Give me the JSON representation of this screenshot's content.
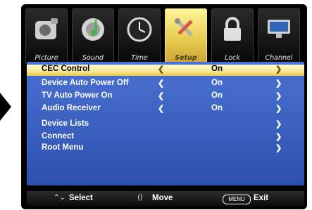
{
  "tabs": [
    {
      "label": "Picture",
      "icon": "camera-icon"
    },
    {
      "label": "Sound",
      "icon": "music-note-icon"
    },
    {
      "label": "Time",
      "icon": "clock-icon"
    },
    {
      "label": "Setup",
      "icon": "tools-icon"
    },
    {
      "label": "Lock",
      "icon": "lock-icon"
    },
    {
      "label": "Channel",
      "icon": "monitor-icon"
    }
  ],
  "menu": {
    "rows": [
      {
        "label": "CEC Control",
        "value": "On"
      },
      {
        "label": "Device Auto Power Off",
        "value": "On"
      },
      {
        "label": "TV Auto Power On",
        "value": "On"
      },
      {
        "label": "Audio Receiver",
        "value": "On"
      },
      {
        "label": "Device Lists",
        "value": ""
      },
      {
        "label": "Connect",
        "value": ""
      },
      {
        "label": "Root Menu",
        "value": ""
      }
    ]
  },
  "footer": {
    "select_label": "Select",
    "move_label": "Move",
    "menu_button_text": "MENU",
    "exit_label": "Exit"
  },
  "colors": {
    "menu_blue": "#3f63c4",
    "highlight_yellow": "#f7e589",
    "tab_selected_gold": "#e5c84a"
  }
}
